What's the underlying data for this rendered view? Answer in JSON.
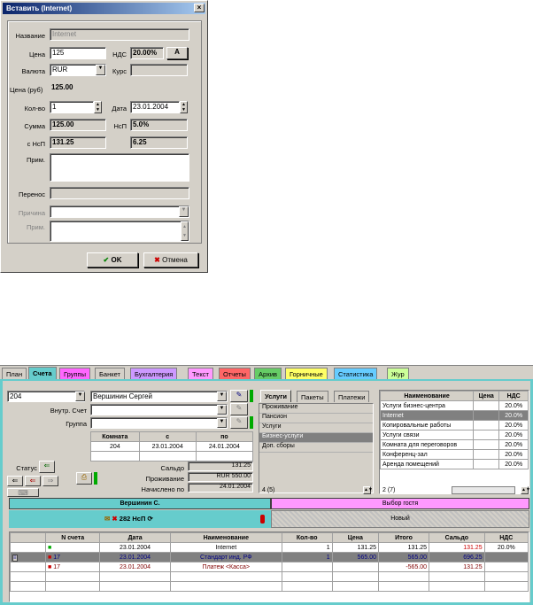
{
  "dialog": {
    "title": "Вставить (Internet)",
    "close": "×",
    "name_label": "Название",
    "name_value": "Internet",
    "price_label": "Цена",
    "price_value": "125",
    "vat_label": "НДС",
    "vat_value": "20.00%",
    "vat_button": "A",
    "currency_label": "Валюта",
    "currency_value": "RUR",
    "rate_label": "Курс",
    "rate_value": "",
    "price_rub_label": "Цена (руб)",
    "price_rub_value": "125.00",
    "qty_label": "Кол-во",
    "qty_value": "1",
    "date_label": "Дата",
    "date_value": "23.01.2004",
    "sum_label": "Сумма",
    "sum_value": "125.00",
    "nsp_label": "НсП",
    "nsp_value": "5.0%",
    "with_nsp_label": "с НсП",
    "with_nsp_value": "131.25",
    "nsp_amount": "6.25",
    "note_label": "Прим.",
    "transfer_label": "Перенос",
    "reason_label": "Причина",
    "note2_label": "Прим.",
    "ok_label": "OK",
    "cancel_label": "Отмена"
  },
  "app": {
    "tabs": [
      "План",
      "Счета",
      "Группы",
      "Банкет",
      "Бухгалтерия",
      "Текст",
      "Отчеты",
      "Архив",
      "Горничные",
      "Статистика",
      "Жур"
    ],
    "tab_colors": [
      "#d4d0c8",
      "#66cccc",
      "#ff66ff",
      "#d4d0c8",
      "#cc99ff",
      "#ff99ff",
      "#ff6666",
      "#66cc66",
      "#ffff66",
      "#66ccff",
      "#ccff99"
    ],
    "room": "204",
    "guest": "Вершинин Сергей",
    "inner_account_label": "Внутр. Счет",
    "group_label": "Группа",
    "stay_headers": [
      "Комната",
      "с",
      "по"
    ],
    "stay_row": [
      "204",
      "23.01.2004",
      "24.01.2004"
    ],
    "status_label": "Статус",
    "balance_label": "Сальдо",
    "balance_value": "131.25",
    "living_label": "Проживание",
    "living_value": "RUR 550.00",
    "charged_label": "Начислено по",
    "charged_value": "24.01.2004",
    "service_tabs": [
      "Услуги",
      "Пакеты",
      "Платежи"
    ],
    "services": [
      "Проживание",
      "Пансион",
      "Услуги",
      "Бизнес-услуги",
      "Доп. сборы"
    ],
    "services_count": "4 (5)",
    "price_headers": [
      "Наименование",
      "Цена",
      "НДС"
    ],
    "price_rows": [
      [
        "Услуги бизнес-центра",
        "",
        "20.0%"
      ],
      [
        "Internet",
        "",
        "20.0%"
      ],
      [
        "Копировальные работы",
        "",
        "20.0%"
      ],
      [
        "Услуги связи",
        "",
        "20.0%"
      ],
      [
        "Комната для переговоров",
        "",
        "20.0%"
      ],
      [
        "Конференц-зал",
        "",
        "20.0%"
      ],
      [
        "Аренда помещений",
        "",
        "20.0%"
      ]
    ],
    "price_count": "2 (7)",
    "guest_tab": "Вершинин С.",
    "choose_tab": "Выбор гостя",
    "account_label": "282 НсП",
    "new_label": "Новый",
    "table_headers": [
      "N счета",
      "Дата",
      "Наименование",
      "Кол-во",
      "Цена",
      "Итого",
      "Сальдо",
      "НДС"
    ],
    "rows": [
      [
        "",
        "23.01.2004",
        "Internet",
        "1",
        "131.25",
        "131.25",
        "131.25",
        "20.0%"
      ],
      [
        "17",
        "23.01.2004",
        "Стандарт инд. РФ",
        "1",
        "565.00",
        "565.00",
        "696.25",
        ""
      ],
      [
        "17",
        "23.01.2004",
        "Платеж <Касса>",
        "",
        "",
        "-565.00",
        "131.25",
        ""
      ]
    ]
  }
}
